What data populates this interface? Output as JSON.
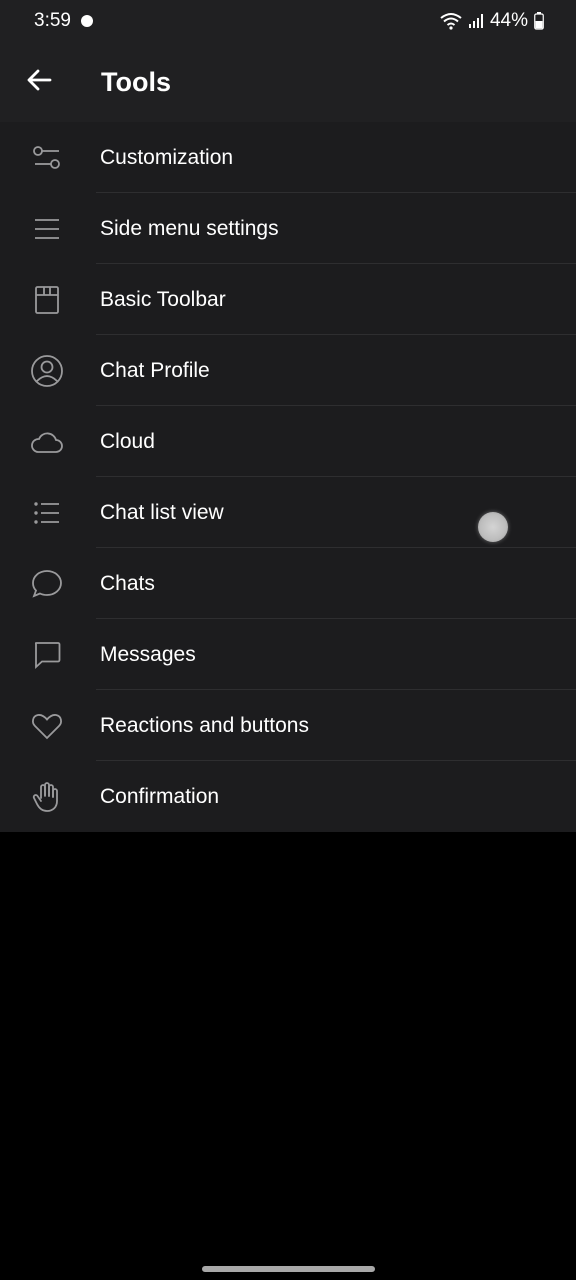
{
  "status_bar": {
    "time": "3:59",
    "battery": "44%"
  },
  "app_bar": {
    "title": "Tools"
  },
  "menu": {
    "items": [
      {
        "label": "Customization",
        "icon": "sliders-icon"
      },
      {
        "label": "Side menu settings",
        "icon": "hamburger-menu-icon"
      },
      {
        "label": "Basic Toolbar",
        "icon": "toolbar-icon"
      },
      {
        "label": "Chat Profile",
        "icon": "user-circle-icon"
      },
      {
        "label": "Cloud",
        "icon": "cloud-icon"
      },
      {
        "label": "Chat list view",
        "icon": "list-icon"
      },
      {
        "label": "Chats",
        "icon": "chat-bubble-round-icon"
      },
      {
        "label": "Messages",
        "icon": "message-square-icon"
      },
      {
        "label": "Reactions and buttons",
        "icon": "heart-icon"
      },
      {
        "label": "Confirmation",
        "icon": "hand-icon"
      }
    ]
  },
  "colors": {
    "app_bar_bg": "#202022",
    "list_bg": "#1c1c1e",
    "divider": "#2e2e30",
    "screen_bg": "#000000",
    "icon_stroke": "#9a9a9c"
  }
}
